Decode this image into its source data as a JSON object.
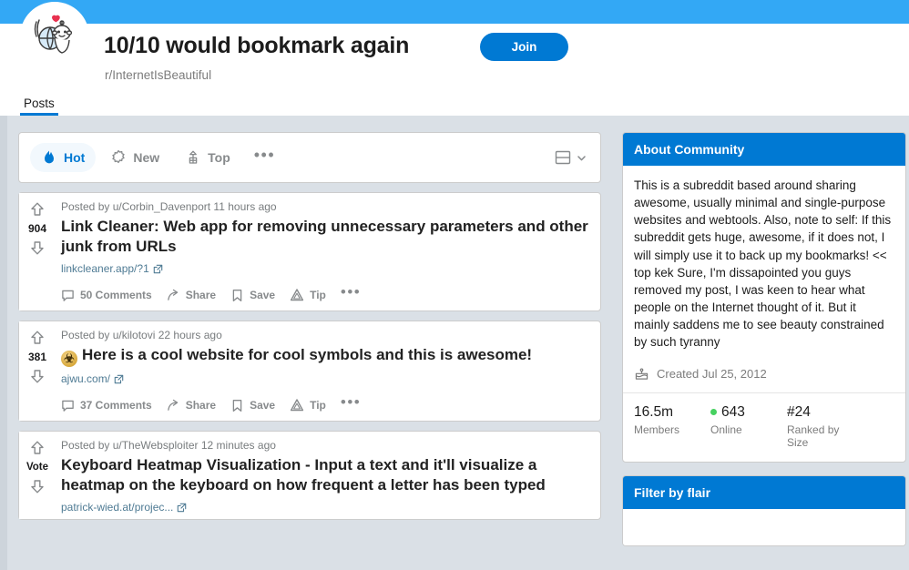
{
  "colors": {
    "banner": "#33a8f5",
    "accent": "#0079d3",
    "page_bg": "#dae0e6",
    "online_green": "#46d160",
    "link": "#4f7b94"
  },
  "header": {
    "title": "10/10 would bookmark again",
    "handle": "r/InternetIsBeautiful",
    "join_label": "Join",
    "avatar_icon": "snoo-globe-avatar"
  },
  "tabs": [
    {
      "label": "Posts",
      "active": true
    }
  ],
  "sortbar": {
    "options": [
      {
        "label": "Hot",
        "icon": "flame-icon",
        "active": true
      },
      {
        "label": "New",
        "icon": "sparkle-icon",
        "active": false
      },
      {
        "label": "Top",
        "icon": "trophy-chart-icon",
        "active": false
      }
    ],
    "more_label": "•••",
    "view_icon": "card-view-icon",
    "view_chevron_icon": "chevron-down-icon"
  },
  "posts": [
    {
      "score": "904",
      "meta": "Posted by u/Corbin_Davenport 11 hours ago",
      "title": "Link Cleaner: Web app for removing unnecessary parameters and other junk from URLs",
      "emoji": "",
      "link": "linkcleaner.app/?1",
      "comments_label": "50 Comments",
      "share_label": "Share",
      "save_label": "Save",
      "tip_label": "Tip",
      "more_label": "•••"
    },
    {
      "score": "381",
      "meta": "Posted by u/kilotovi 22 hours ago",
      "title": "Here is a cool website for cool symbols and this is awesome!",
      "emoji": "☣",
      "link": "ajwu.com/",
      "comments_label": "37 Comments",
      "share_label": "Share",
      "save_label": "Save",
      "tip_label": "Tip",
      "more_label": "•••"
    },
    {
      "score": "Vote",
      "meta": "Posted by u/TheWebsploiter 12 minutes ago",
      "title": "Keyboard Heatmap Visualization - Input a text and it'll visualize a heatmap on the keyboard on how frequent a letter has been typed",
      "emoji": "",
      "link": "patrick-wied.at/projec...",
      "comments_label": "",
      "share_label": "",
      "save_label": "",
      "tip_label": "",
      "more_label": ""
    }
  ],
  "sidebar": {
    "about": {
      "heading": "About Community",
      "description": "This is a subreddit based around sharing awesome, usually minimal and single-purpose websites and webtools. Also, note to self: If this subreddit gets huge, awesome, if it does not, I will simply use it to back up my bookmarks! << top kek Sure, I'm dissapointed you guys removed my post, I was keen to hear what people on the Internet thought of it. But it mainly saddens me to see beauty constrained by such tyranny",
      "created": "Created Jul 25, 2012",
      "created_icon": "cake-icon",
      "stats": [
        {
          "value": "16.5m",
          "label": "Members",
          "dot": false
        },
        {
          "value": "643",
          "label": "Online",
          "dot": true
        },
        {
          "value": "#24",
          "label": "Ranked by Size",
          "dot": false
        }
      ]
    },
    "flair": {
      "heading": "Filter by flair"
    }
  }
}
